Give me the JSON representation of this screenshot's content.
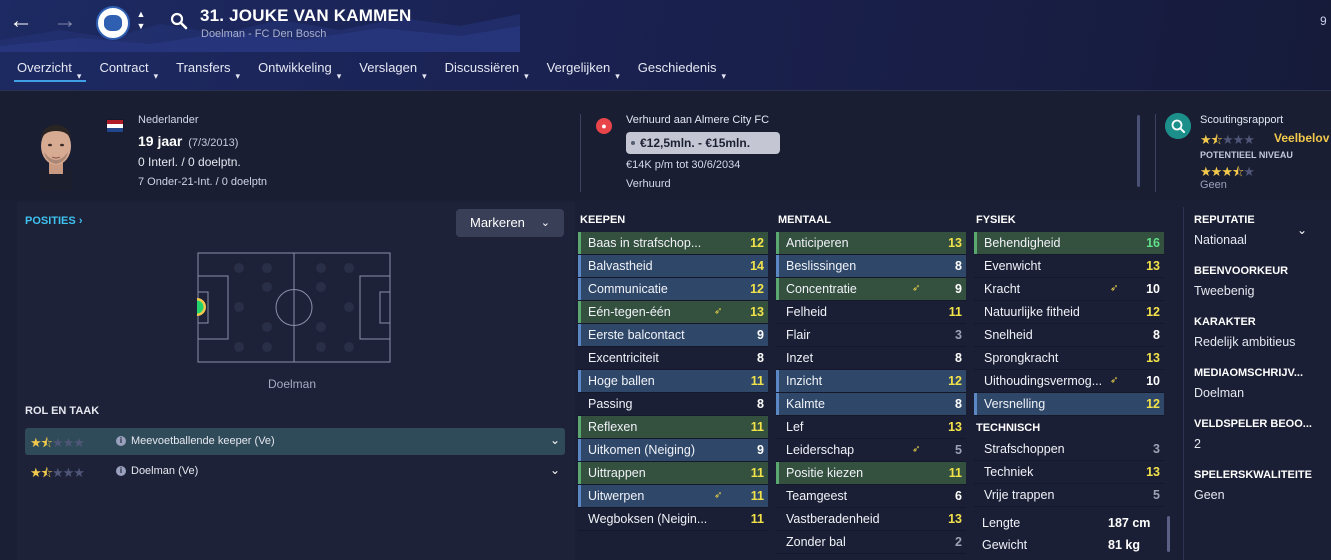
{
  "header": {
    "player_name": "31. JOUKE VAN KAMMEN",
    "subtitle": "Doelman - FC Den Bosch",
    "top_right_glyph": "9"
  },
  "tabs": [
    {
      "label": "Overzicht",
      "active": true
    },
    {
      "label": "Contract"
    },
    {
      "label": "Transfers"
    },
    {
      "label": "Ontwikkeling"
    },
    {
      "label": "Verslagen"
    },
    {
      "label": "Discussiëren"
    },
    {
      "label": "Vergelijken"
    },
    {
      "label": "Geschiedenis"
    }
  ],
  "profile": {
    "nationality": "Nederlander",
    "age": "19 jaar",
    "dob": "(7/3/2013)",
    "international": "0 Interl. / 0 doelptn.",
    "u21": "7 Onder-21-Int. / 0 doelptn"
  },
  "contract": {
    "loan_text": "Verhuurd aan Almere City FC",
    "value": "€12,5mln. - €15mln.",
    "wage": "€14K p/m tot 30/6/2034",
    "status": "Verhuurd"
  },
  "scouting": {
    "title": "Scoutingsrapport",
    "current_label": "Veelbelov",
    "current_stars": 1.5,
    "potential_title": "POTENTIEEL NIVEAU",
    "potential_stars": 3.5,
    "potential_note": "Geen"
  },
  "positions": {
    "title": "POSITIES",
    "mark_button": "Markeren",
    "position_label": "Doelman"
  },
  "roles": {
    "title": "ROL EN TAAK",
    "items": [
      {
        "name": "Meevoetballende keeper (Ve)",
        "stars": 1.5
      },
      {
        "name": "Doelman (Ve)",
        "stars": 1.5
      }
    ]
  },
  "keepen": {
    "title": "KEEPEN",
    "rows": [
      {
        "name": "Baas in strafschop...",
        "value": "12",
        "style": "green",
        "color": "yellow"
      },
      {
        "name": "Balvastheid",
        "value": "14",
        "style": "blue",
        "color": "yellow"
      },
      {
        "name": "Communicatie",
        "value": "12",
        "style": "blue",
        "color": "yellow"
      },
      {
        "name": "Eén-tegen-één",
        "value": "13",
        "style": "green",
        "color": "yellow",
        "trend": true
      },
      {
        "name": "Eerste balcontact",
        "value": "9",
        "style": "blue",
        "color": "white"
      },
      {
        "name": "Excentriciteit",
        "value": "8",
        "style": "",
        "color": "white"
      },
      {
        "name": "Hoge ballen",
        "value": "11",
        "style": "blue",
        "color": "yellow"
      },
      {
        "name": "Passing",
        "value": "8",
        "style": "",
        "color": "white"
      },
      {
        "name": "Reflexen",
        "value": "11",
        "style": "green",
        "color": "yellow"
      },
      {
        "name": "Uitkomen (Neiging)",
        "value": "9",
        "style": "blue",
        "color": "white"
      },
      {
        "name": "Uittrappen",
        "value": "11",
        "style": "green",
        "color": "yellow"
      },
      {
        "name": "Uitwerpen",
        "value": "11",
        "style": "blue",
        "color": "yellow",
        "trend": true
      },
      {
        "name": "Wegboksen (Neigin...",
        "value": "11",
        "style": "",
        "color": "yellow"
      }
    ]
  },
  "mentaal": {
    "title": "MENTAAL",
    "rows": [
      {
        "name": "Anticiperen",
        "value": "13",
        "style": "green",
        "color": "yellow"
      },
      {
        "name": "Beslissingen",
        "value": "8",
        "style": "blue",
        "color": "white"
      },
      {
        "name": "Concentratie",
        "value": "9",
        "style": "green",
        "color": "white",
        "trend": true
      },
      {
        "name": "Felheid",
        "value": "11",
        "style": "",
        "color": "yellow"
      },
      {
        "name": "Flair",
        "value": "3",
        "style": "",
        "color": "grey"
      },
      {
        "name": "Inzet",
        "value": "8",
        "style": "",
        "color": "white"
      },
      {
        "name": "Inzicht",
        "value": "12",
        "style": "blue",
        "color": "yellow"
      },
      {
        "name": "Kalmte",
        "value": "8",
        "style": "blue",
        "color": "white"
      },
      {
        "name": "Lef",
        "value": "13",
        "style": "",
        "color": "yellow"
      },
      {
        "name": "Leiderschap",
        "value": "5",
        "style": "",
        "color": "grey",
        "trend": true
      },
      {
        "name": "Positie kiezen",
        "value": "11",
        "style": "green",
        "color": "yellow"
      },
      {
        "name": "Teamgeest",
        "value": "6",
        "style": "",
        "color": "white"
      },
      {
        "name": "Vastberadenheid",
        "value": "13",
        "style": "",
        "color": "yellow"
      },
      {
        "name": "Zonder bal",
        "value": "2",
        "style": "",
        "color": "grey"
      }
    ]
  },
  "fysiek": {
    "title": "FYSIEK",
    "rows": [
      {
        "name": "Behendigheid",
        "value": "16",
        "style": "green",
        "color": "green"
      },
      {
        "name": "Evenwicht",
        "value": "13",
        "style": "",
        "color": "yellow"
      },
      {
        "name": "Kracht",
        "value": "10",
        "style": "",
        "color": "white",
        "trend": true
      },
      {
        "name": "Natuurlijke fitheid",
        "value": "12",
        "style": "",
        "color": "yellow"
      },
      {
        "name": "Snelheid",
        "value": "8",
        "style": "",
        "color": "white"
      },
      {
        "name": "Sprongkracht",
        "value": "13",
        "style": "",
        "color": "yellow"
      },
      {
        "name": "Uithoudingsvermog...",
        "value": "10",
        "style": "",
        "color": "white",
        "trend": true
      },
      {
        "name": "Versnelling",
        "value": "12",
        "style": "blue",
        "color": "yellow"
      }
    ]
  },
  "technisch": {
    "title": "TECHNISCH",
    "rows": [
      {
        "name": "Strafschoppen",
        "value": "3",
        "style": "",
        "color": "grey"
      },
      {
        "name": "Techniek",
        "value": "13",
        "style": "",
        "color": "yellow"
      },
      {
        "name": "Vrije trappen",
        "value": "5",
        "style": "",
        "color": "grey"
      }
    ]
  },
  "physical_stats": [
    {
      "name": "Lengte",
      "value": "187 cm"
    },
    {
      "name": "Gewicht",
      "value": "81 kg"
    }
  ],
  "side_info": [
    {
      "label": "REPUTATIE",
      "value": "Nationaal"
    },
    {
      "label": "BEENVOORKEUR",
      "value": "Tweebenig"
    },
    {
      "label": "KARAKTER",
      "value": "Redelijk ambitieus"
    },
    {
      "label": "MEDIAOMSCHRIJV...",
      "value": "Doelman"
    },
    {
      "label": "VELDSPELER BEOO...",
      "value": "2"
    },
    {
      "label": "SPELERSKWALITEITE",
      "value": "Geen"
    }
  ],
  "colors": {
    "accent": "#3fa0e6",
    "positions_title": "#3ec2f0",
    "star": "#f2c94c",
    "attr_high": "#f2e24a",
    "attr_top": "#5fe08a",
    "loan_icon": "#e8454b",
    "scout_icon": "#1c8f8a",
    "position_dot": "#22d36b"
  }
}
